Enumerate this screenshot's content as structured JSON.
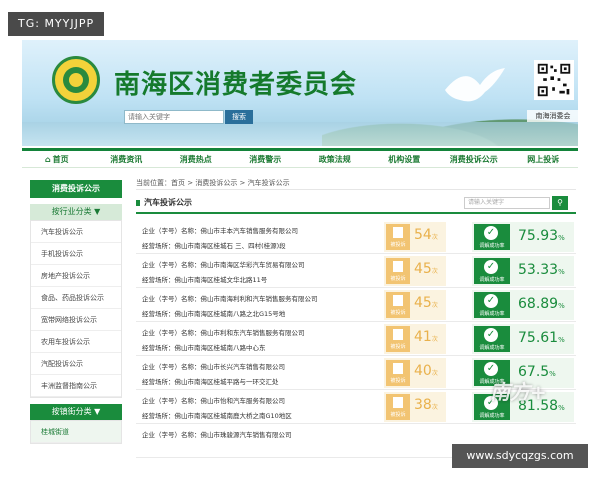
{
  "watermark_top": "TG: MYYJJPP",
  "watermark_bottom": "www.sdycqzgs.com",
  "watermark_logo": "南方+",
  "header": {
    "title": "南海区消费者委员会",
    "search_placeholder": "请输入关键字",
    "search_button": "搜索",
    "qr_label": "南海消委会"
  },
  "nav": [
    "首页",
    "消费资讯",
    "消费热点",
    "消费警示",
    "政策法规",
    "机构设置",
    "消费投诉公示",
    "网上投诉"
  ],
  "sidebar": {
    "head": "消费投诉公示",
    "group1": "按行业分类 ▼",
    "items": [
      "汽车投诉公示",
      "手机投诉公示",
      "房地产投诉公示",
      "食品、药品投诉公示",
      "宽带网络投诉公示",
      "农用车投诉公示",
      "汽配投诉公示",
      "丰洲监督指南公示"
    ],
    "group2": "按镇街分类 ▼",
    "items2": [
      "桂城街道"
    ]
  },
  "breadcrumb": "当前位置：首页 > 消费投诉公示 > 汽车投诉公示",
  "section": {
    "title": "汽车投诉公示",
    "search_placeholder": "请输入关键字",
    "search_icon": "search-icon"
  },
  "labels": {
    "complaint": "被投诉",
    "resolved": "调解成功率",
    "count_unit": "次",
    "pct": "%"
  },
  "rows": [
    {
      "company": "企业（字号）名称：佛山市丰本汽车销售服务有限公司",
      "address": "经营场所：佛山市南海区桂城石 三、四村(桂源)段",
      "count": "54",
      "rate": "75.93"
    },
    {
      "company": "企业（字号）名称：佛山市南海区华彩汽车贸易有限公司",
      "address": "经营场所：佛山市南海区桂城文华北路11号",
      "count": "45",
      "rate": "53.33"
    },
    {
      "company": "企业（字号）名称：佛山市南海利利和汽车销售服务有限公司",
      "address": "经营场所：佛山市南海区桂城南八路之北G15号地",
      "count": "45",
      "rate": "68.89"
    },
    {
      "company": "企业（字号）名称：佛山市利和东汽车销售服务有限公司",
      "address": "经营场所：佛山市南海区桂城南八路中心东",
      "count": "41",
      "rate": "75.61"
    },
    {
      "company": "企业（字号）名称：佛山市长兴汽车销售有限公司",
      "address": "经营场所：佛山市南海区桂城平路与一环交汇处",
      "count": "40",
      "rate": "67.5"
    },
    {
      "company": "企业（字号）名称：佛山市怡和汽车服务有限公司",
      "address": "经营场所：佛山市南海区桂城南鹿大桥之南G10地区",
      "count": "38",
      "rate": "81.58"
    },
    {
      "company": "企业（字号）名称：佛山市珠骏源汽车销售有限公司",
      "address": "",
      "count": "",
      "rate": ""
    }
  ],
  "colors": {
    "primary_green": "#1a8c3d",
    "count_orange": "#e9b14c",
    "title_green": "#157a2c"
  }
}
